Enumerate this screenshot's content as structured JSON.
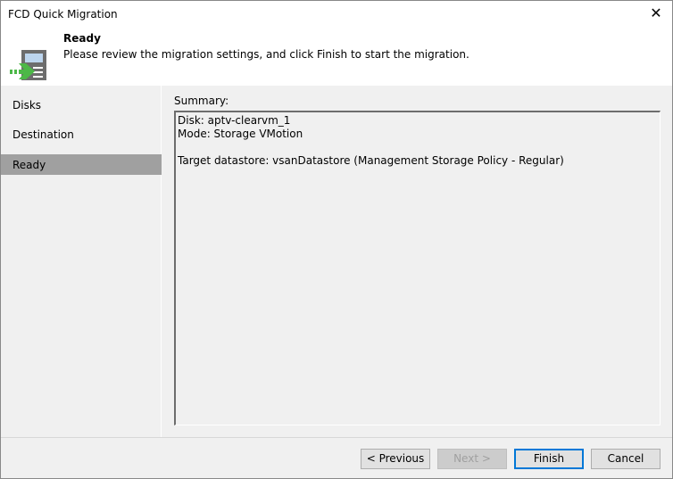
{
  "window": {
    "title": "FCD Quick Migration",
    "close_label": "✕"
  },
  "header": {
    "title": "Ready",
    "description": "Please review the migration settings, and click Finish to start the migration.",
    "icon": "migration-wizard-icon",
    "accent_color": "#4cb847"
  },
  "nav": {
    "items": [
      {
        "label": "Disks"
      },
      {
        "label": "Destination"
      },
      {
        "label": "Ready",
        "selected": true
      }
    ]
  },
  "summary": {
    "label": "Summary:",
    "lines": [
      "Disk: aptv-clearvm_1",
      "Mode: Storage VMotion",
      "",
      "Target datastore: vsanDatastore (Management Storage Policy - Regular)"
    ]
  },
  "buttons": {
    "previous": "< Previous",
    "next": "Next >",
    "finish": "Finish",
    "cancel": "Cancel"
  }
}
